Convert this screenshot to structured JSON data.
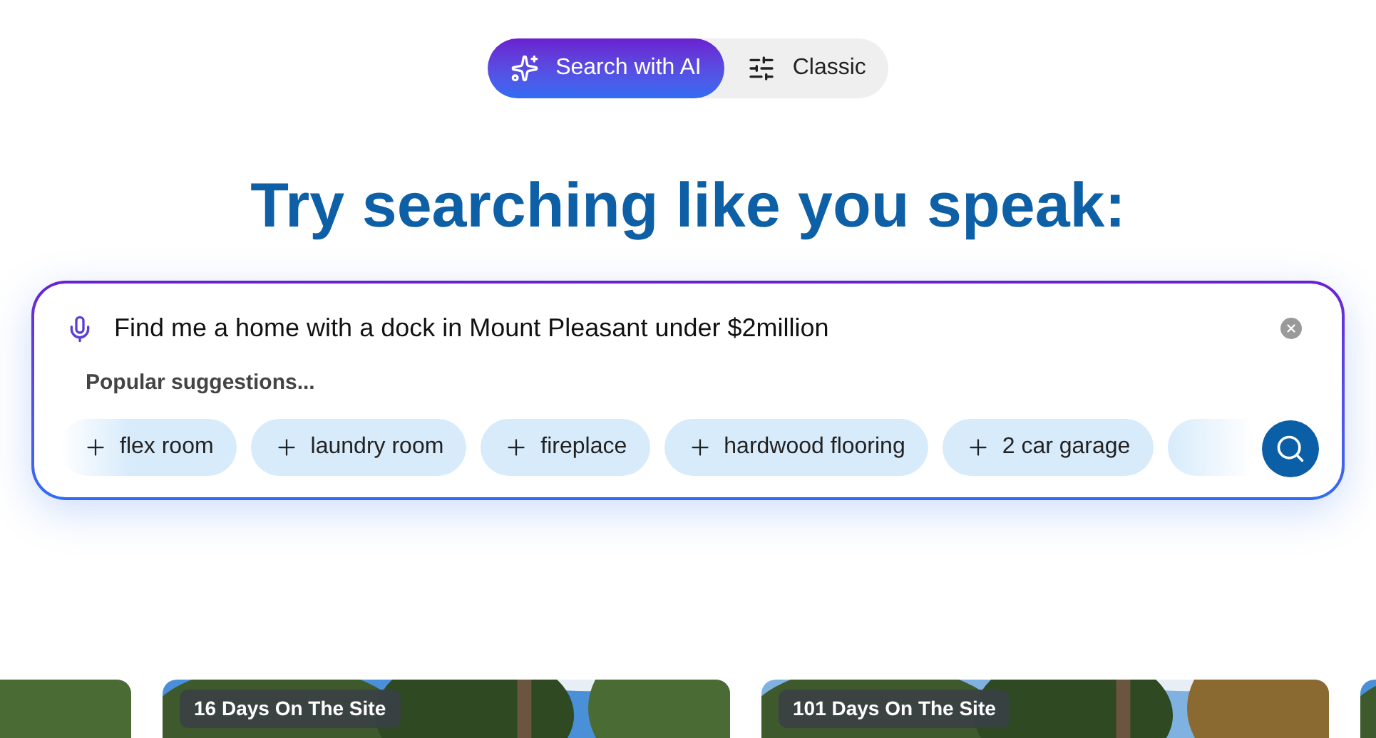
{
  "mode_toggle": [
    {
      "label": "Search with AI",
      "selected": true
    },
    {
      "label": "Classic",
      "selected": false
    }
  ],
  "heading": "Try searching like you speak:",
  "search": {
    "value": "Find me a home with a dock in Mount Pleasant under $2million",
    "suggestions_label": "Popular suggestions...",
    "suggestions": [
      "flex room",
      "laundry room",
      "fireplace",
      "hardwood flooring",
      "2 car garage"
    ]
  },
  "listings": [
    {
      "kind": "picture"
    },
    {
      "kind": "picture",
      "badge": "16 Days On The Site"
    },
    {
      "kind": "picture",
      "badge": "101 Days On The Site"
    },
    {
      "kind": "picture"
    }
  ]
}
